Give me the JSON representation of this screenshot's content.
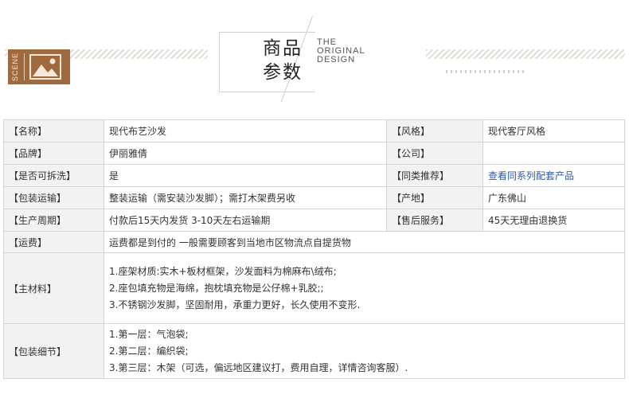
{
  "header": {
    "scene_label": "SCENE",
    "title_cn_line1": "商品",
    "title_cn_line2": "参数",
    "title_en_line1": "THE",
    "title_en_line2": "ORIGINAL",
    "title_en_line3": "DESIGN",
    "icons": {
      "picture": "picture-icon"
    },
    "colors": {
      "badge": "#a06a3f",
      "hatch": "#e2dcd6"
    }
  },
  "params": {
    "name_label": "【名称】",
    "name_value": "现代布艺沙发",
    "style_label": "【风格】",
    "style_value": "现代客厅风格",
    "brand_label": "【品牌】",
    "brand_value": "伊丽雅倩",
    "company_label": "【公司】",
    "company_value": "",
    "removable_label": "【是否可拆洗】",
    "removable_value": "是",
    "similar_label": "【同类推荐】",
    "similar_value": "查看同系列配套产品",
    "packaging_label": "【包装运输】",
    "packaging_value": "整装运输（需安装沙发脚）；需打木架费另收",
    "origin_label": "【产地】",
    "origin_value": "广东佛山",
    "production_label": "【生产周期】",
    "production_value": "付款后15天内发货 3-10天左右运输期",
    "aftersale_label": "【售后服务】",
    "aftersale_value": "45天无理由退换货",
    "freight_label": "【运费】",
    "freight_value": "运费都是到付的 一般需要顾客到当地市区物流点自提货物",
    "material_label": "【主材料】",
    "material_lines": [
      "1.座架材质:实木+板材框架，沙发面料为棉麻布\\绒布;",
      "2.座包填充物是海绵，抱枕填充物是公仔棉+乳胶;;",
      "3.不锈钢沙发脚，坚固耐用，承重力更好，长久使用不变形."
    ],
    "pack_detail_label": "【包装细节】",
    "pack_detail_lines": [
      "1.第一层：气泡袋;",
      "2.第二层：编织袋;",
      "3.第三层：木架（可选，偏远地区建议打，费用自理，详情咨询客服）."
    ],
    "colors": {
      "label_bg": "#f2f2f2",
      "border": "#d4d4d4",
      "link": "#2b5aa8"
    }
  }
}
